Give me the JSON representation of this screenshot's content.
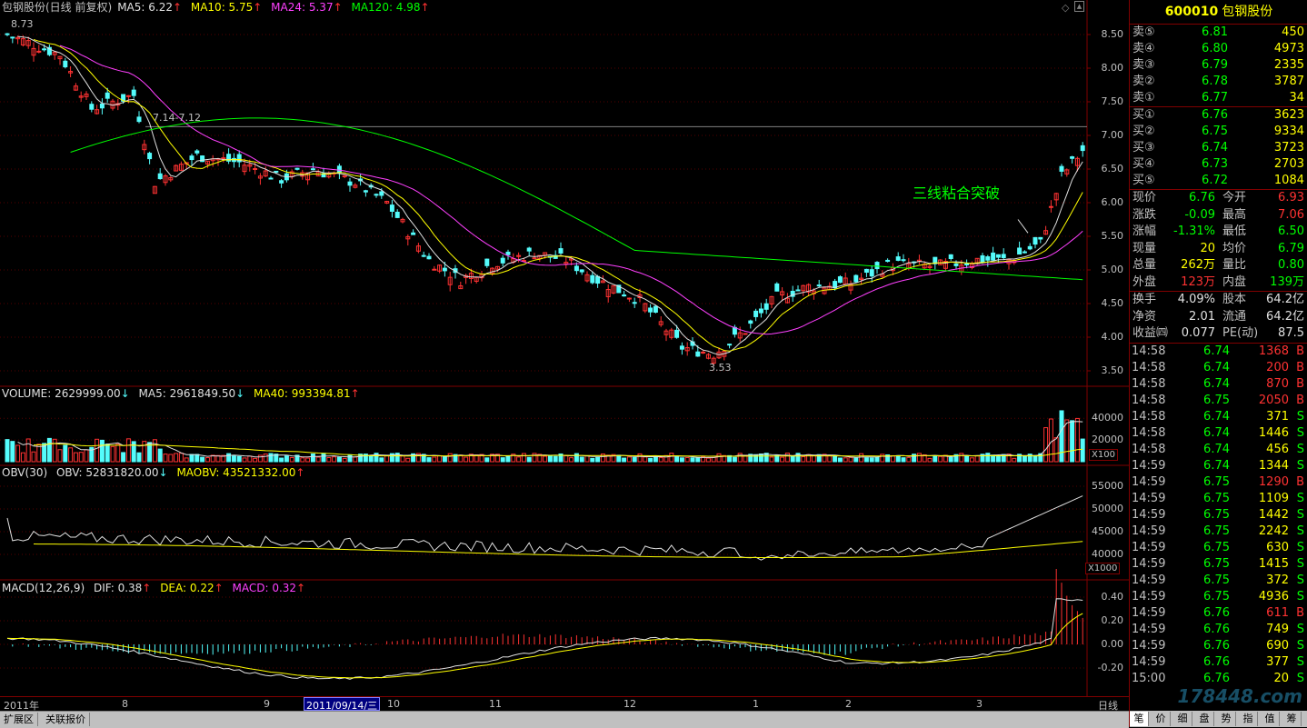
{
  "main_header": {
    "name": "包钢股份(日线 前复权)",
    "ma5": "MA5: 6.22",
    "ma10": "MA10: 5.75",
    "ma24": "MA24: 5.37",
    "ma120": "MA120: 4.98"
  },
  "main_axis": [
    "8.50",
    "8.00",
    "7.50",
    "7.00",
    "6.50",
    "6.00",
    "5.50",
    "5.00",
    "4.50",
    "4.00",
    "3.50"
  ],
  "markers": {
    "high": "8.73",
    "range": "7.14-7.12",
    "low": "3.53"
  },
  "annotation": "三线粘合突破",
  "volume_header": {
    "vol": "VOLUME: 2629999.00",
    "ma5": "MA5: 2961849.50",
    "ma40": "MA40: 993394.81"
  },
  "volume_axis": [
    "40000",
    "20000"
  ],
  "volume_unit": "X100",
  "obv_header": {
    "name": "OBV(30)",
    "obv": "OBV: 52831820.00",
    "maobv": "MAOBV: 43521332.00"
  },
  "obv_axis": [
    "55000",
    "50000",
    "45000",
    "40000"
  ],
  "obv_unit": "X1000",
  "macd_header": {
    "name": "MACD(12,26,9)",
    "dif": "DIF: 0.38",
    "dea": "DEA: 0.22",
    "macd": "MACD: 0.32"
  },
  "macd_axis": [
    "0.40",
    "0.20",
    "0.00",
    "-0.20"
  ],
  "date_axis": {
    "labels": [
      "2011年",
      "8",
      "9",
      "10",
      "11",
      "12",
      "1",
      "2",
      "3"
    ],
    "cursor": "2011/09/14/三",
    "period": "日线"
  },
  "bottom_tabs": [
    "扩展区",
    "关联报价"
  ],
  "quote": {
    "code": "600010",
    "name": "包钢股份",
    "sells": [
      {
        "label": "卖⑤",
        "price": "6.81",
        "vol": "450"
      },
      {
        "label": "卖④",
        "price": "6.80",
        "vol": "4973"
      },
      {
        "label": "卖③",
        "price": "6.79",
        "vol": "2335"
      },
      {
        "label": "卖②",
        "price": "6.78",
        "vol": "3787"
      },
      {
        "label": "卖①",
        "price": "6.77",
        "vol": "34"
      }
    ],
    "buys": [
      {
        "label": "买①",
        "price": "6.76",
        "vol": "3623"
      },
      {
        "label": "买②",
        "price": "6.75",
        "vol": "9334"
      },
      {
        "label": "买③",
        "price": "6.74",
        "vol": "3723"
      },
      {
        "label": "买④",
        "price": "6.73",
        "vol": "2703"
      },
      {
        "label": "买⑤",
        "price": "6.72",
        "vol": "1084"
      }
    ],
    "stats": [
      {
        "l1": "现价",
        "v1": "6.76",
        "c1": "#00ff00",
        "l2": "今开",
        "v2": "6.93",
        "c2": "#ff3232"
      },
      {
        "l1": "涨跌",
        "v1": "-0.09",
        "c1": "#00ff00",
        "l2": "最高",
        "v2": "7.06",
        "c2": "#ff3232"
      },
      {
        "l1": "涨幅",
        "v1": "-1.31%",
        "c1": "#00ff00",
        "l2": "最低",
        "v2": "6.50",
        "c2": "#00ff00"
      },
      {
        "l1": "现量",
        "v1": "20",
        "c1": "#ffff00",
        "l2": "均价",
        "v2": "6.79",
        "c2": "#00ff00"
      },
      {
        "l1": "总量",
        "v1": "262万",
        "c1": "#ffff00",
        "l2": "量比",
        "v2": "0.80",
        "c2": "#00ff00"
      },
      {
        "l1": "外盘",
        "v1": "123万",
        "c1": "#ff3232",
        "l2": "内盘",
        "v2": "139万",
        "c2": "#00ff00"
      }
    ],
    "stats2": [
      {
        "l1": "换手",
        "v1": "4.09%",
        "c1": "#e0e0e0",
        "l2": "股本",
        "v2": "64.2亿",
        "c2": "#e0e0e0"
      },
      {
        "l1": "净资",
        "v1": "2.01",
        "c1": "#e0e0e0",
        "l2": "流通",
        "v2": "64.2亿",
        "c2": "#e0e0e0"
      },
      {
        "l1": "收益㈣",
        "v1": "0.077",
        "c1": "#e0e0e0",
        "l2": "PE(动)",
        "v2": "87.5",
        "c2": "#e0e0e0"
      }
    ],
    "ticks": [
      {
        "t": "14:58",
        "p": "6.74",
        "v": "1368",
        "f": "B"
      },
      {
        "t": "14:58",
        "p": "6.74",
        "v": "200",
        "f": "B"
      },
      {
        "t": "14:58",
        "p": "6.74",
        "v": "870",
        "f": "B"
      },
      {
        "t": "14:58",
        "p": "6.75",
        "v": "2050",
        "f": "B"
      },
      {
        "t": "14:58",
        "p": "6.74",
        "v": "371",
        "f": "S"
      },
      {
        "t": "14:58",
        "p": "6.74",
        "v": "1446",
        "f": "S"
      },
      {
        "t": "14:58",
        "p": "6.74",
        "v": "456",
        "f": "S"
      },
      {
        "t": "14:59",
        "p": "6.74",
        "v": "1344",
        "f": "S"
      },
      {
        "t": "14:59",
        "p": "6.75",
        "v": "1290",
        "f": "B"
      },
      {
        "t": "14:59",
        "p": "6.75",
        "v": "1109",
        "f": "S"
      },
      {
        "t": "14:59",
        "p": "6.75",
        "v": "1442",
        "f": "S"
      },
      {
        "t": "14:59",
        "p": "6.75",
        "v": "2242",
        "f": "S"
      },
      {
        "t": "14:59",
        "p": "6.75",
        "v": "630",
        "f": "S"
      },
      {
        "t": "14:59",
        "p": "6.75",
        "v": "1415",
        "f": "S"
      },
      {
        "t": "14:59",
        "p": "6.75",
        "v": "372",
        "f": "S"
      },
      {
        "t": "14:59",
        "p": "6.75",
        "v": "4936",
        "f": "S"
      },
      {
        "t": "14:59",
        "p": "6.76",
        "v": "611",
        "f": "B"
      },
      {
        "t": "14:59",
        "p": "6.76",
        "v": "749",
        "f": "S"
      },
      {
        "t": "14:59",
        "p": "6.76",
        "v": "690",
        "f": "S"
      },
      {
        "t": "14:59",
        "p": "6.76",
        "v": "377",
        "f": "S"
      },
      {
        "t": "15:00",
        "p": "6.76",
        "v": "20",
        "f": "S"
      }
    ],
    "tabs": [
      "笔",
      "价",
      "细",
      "盘",
      "势",
      "指",
      "值",
      "筹"
    ]
  },
  "watermark": "178448.com"
}
